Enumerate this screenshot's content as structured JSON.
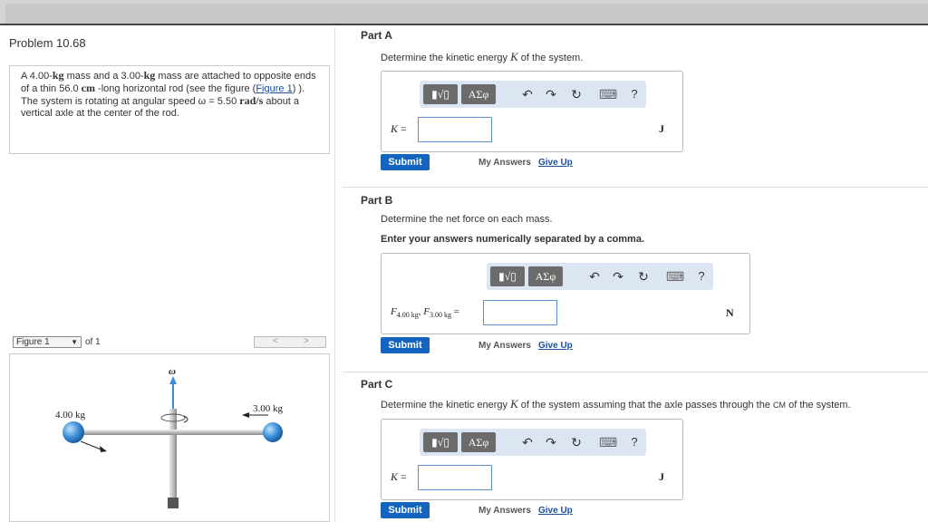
{
  "problem": {
    "title": "Problem 10.68",
    "text_parts": [
      "A 4.00-",
      "kg",
      " mass and a 3.00-",
      "kg",
      " mass are attached to opposite ends of a thin 56.0 ",
      "cm",
      " -long horizontal rod (see the figure (",
      "Figure 1",
      ") ). The system is rotating at angular speed ",
      "ω = 5.50 ",
      "rad/s",
      " about a vertical axle at the center of the rod."
    ]
  },
  "figure": {
    "select_label": "Figure 1",
    "of_label": "of 1",
    "prev": "<",
    "next": ">",
    "omega_label": "ω⃗",
    "left_mass_label": "4.00 kg",
    "right_mass_label": "3.00 kg"
  },
  "toolbar": {
    "templates_label": "▮√▯",
    "symbols_label": "ΑΣφ",
    "undo_icon": "↶",
    "redo_icon": "↷",
    "reset_icon": "↻",
    "keyboard_icon": "⌨",
    "help_label": "?"
  },
  "parts": {
    "a": {
      "title": "Part A",
      "question": "Determine the kinetic energy K of the system.",
      "label": "K =",
      "unit": "J",
      "submit": "Submit",
      "my_answers": "My Answers",
      "give_up": "Give Up"
    },
    "b": {
      "title": "Part B",
      "question": "Determine the net force on each mass.",
      "instruction": "Enter your answers numerically separated by a comma.",
      "label": "F4.00 kg, F3.00 kg =",
      "unit": "N",
      "submit": "Submit",
      "my_answers": "My Answers",
      "give_up": "Give Up"
    },
    "c": {
      "title": "Part C",
      "question": "Determine the kinetic energy K of the system assuming that the axle passes through the CM of the system.",
      "label": "K =",
      "unit": "J",
      "submit": "Submit",
      "my_answers": "My Answers",
      "give_up": "Give Up"
    }
  },
  "colors": {
    "submit_bg": "#1565c0",
    "link": "#1a4f9c",
    "toolbar_bg": "#dce6f2",
    "mass_blue": "#3b8fd8"
  }
}
